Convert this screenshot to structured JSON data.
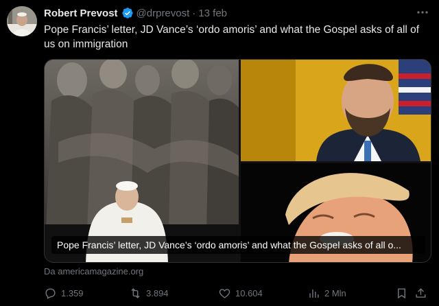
{
  "author": {
    "name": "Robert Prevost",
    "handle": "@drprevost",
    "separator": "·",
    "time": "13 feb",
    "verified": true,
    "verified_color": "#1d9bf0"
  },
  "tweet": {
    "text": "Pope Francis’ letter, JD Vance’s ‘ordo amoris’ and what the Gospel asks of all of us on immigration"
  },
  "card": {
    "caption": "Pope Francis’ letter, JD Vance’s ‘ordo amoris’ and what the Gospel asks of all o...",
    "source": "Da americamagazine.org"
  },
  "actions": {
    "replies": "1.359",
    "retweets": "3.894",
    "likes": "10.604",
    "views": "2 Mln"
  },
  "icons": [
    "more-icon",
    "verified-badge-icon",
    "reply-icon",
    "retweet-icon",
    "like-icon",
    "views-icon",
    "bookmark-icon",
    "share-icon"
  ],
  "colors": {
    "background": "#000000",
    "text": "#e7e9ea",
    "muted": "#71767b",
    "accent": "#1d9bf0"
  }
}
